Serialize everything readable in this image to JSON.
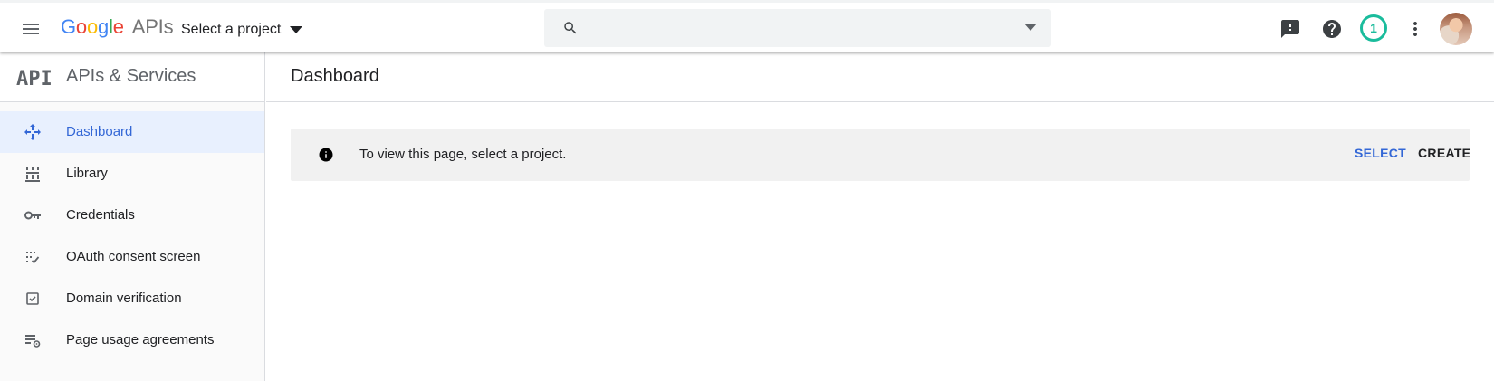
{
  "header": {
    "logo_google": [
      "G",
      "o",
      "o",
      "g",
      "l",
      "e"
    ],
    "logo_apis": "APIs",
    "project_picker_label": "Select a project",
    "search": {
      "value": "",
      "placeholder": ""
    },
    "notification_count": "1",
    "icons": [
      "menu-icon",
      "search-icon",
      "dropdown-arrow-icon",
      "feedback-icon",
      "help-icon",
      "more-vert-icon",
      "avatar"
    ]
  },
  "sidebar": {
    "logo_text": "API",
    "title": "APIs & Services",
    "items": [
      {
        "label": "Dashboard",
        "icon": "dashboard-icon",
        "active": true
      },
      {
        "label": "Library",
        "icon": "library-icon",
        "active": false
      },
      {
        "label": "Credentials",
        "icon": "key-icon",
        "active": false
      },
      {
        "label": "OAuth consent screen",
        "icon": "oauth-consent-icon",
        "active": false
      },
      {
        "label": "Domain verification",
        "icon": "checkbox-icon",
        "active": false
      },
      {
        "label": "Page usage agreements",
        "icon": "list-settings-icon",
        "active": false
      }
    ]
  },
  "main": {
    "title": "Dashboard",
    "notice": {
      "message": "To view this page, select a project.",
      "select_label": "SELECT",
      "create_label": "CREATE"
    }
  },
  "colors": {
    "accent_blue": "#3367d6",
    "active_nav_bg": "#e8f0fe",
    "badge_teal": "#1abc9c",
    "notice_bg": "#f1f1f1"
  }
}
